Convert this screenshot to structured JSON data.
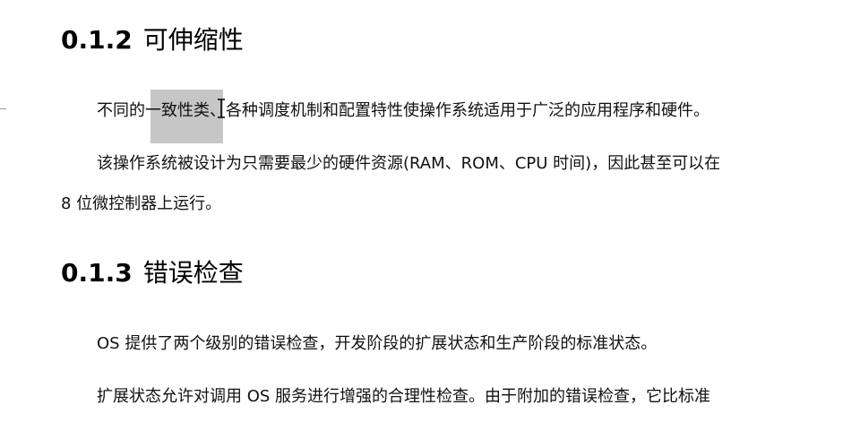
{
  "sections": [
    {
      "number": "0.1.2",
      "title": "可伸缩性",
      "paragraphs": [
        "不同的一致性类、各种调度机制和配置特性使操作系统适用于广泛的应用程序和硬件。",
        "该操作系统被设计为只需要最少的硬件资源(RAM、ROM、CPU 时间)，因此甚至可以在",
        "8 位微控制器上运行。"
      ]
    },
    {
      "number": "0.1.3",
      "title": "错误检查",
      "paragraphs": [
        "OS 提供了两个级别的错误检查，开发阶段的扩展状态和生产阶段的标准状态。",
        "扩展状态允许对调用 OS 服务进行增强的合理性检查。由于附加的错误检查，它比标准"
      ]
    }
  ],
  "selection": {
    "text": "一致性类",
    "color": "#c6c6c6"
  },
  "cursor": {
    "icon": "i-beam-cursor-icon"
  }
}
